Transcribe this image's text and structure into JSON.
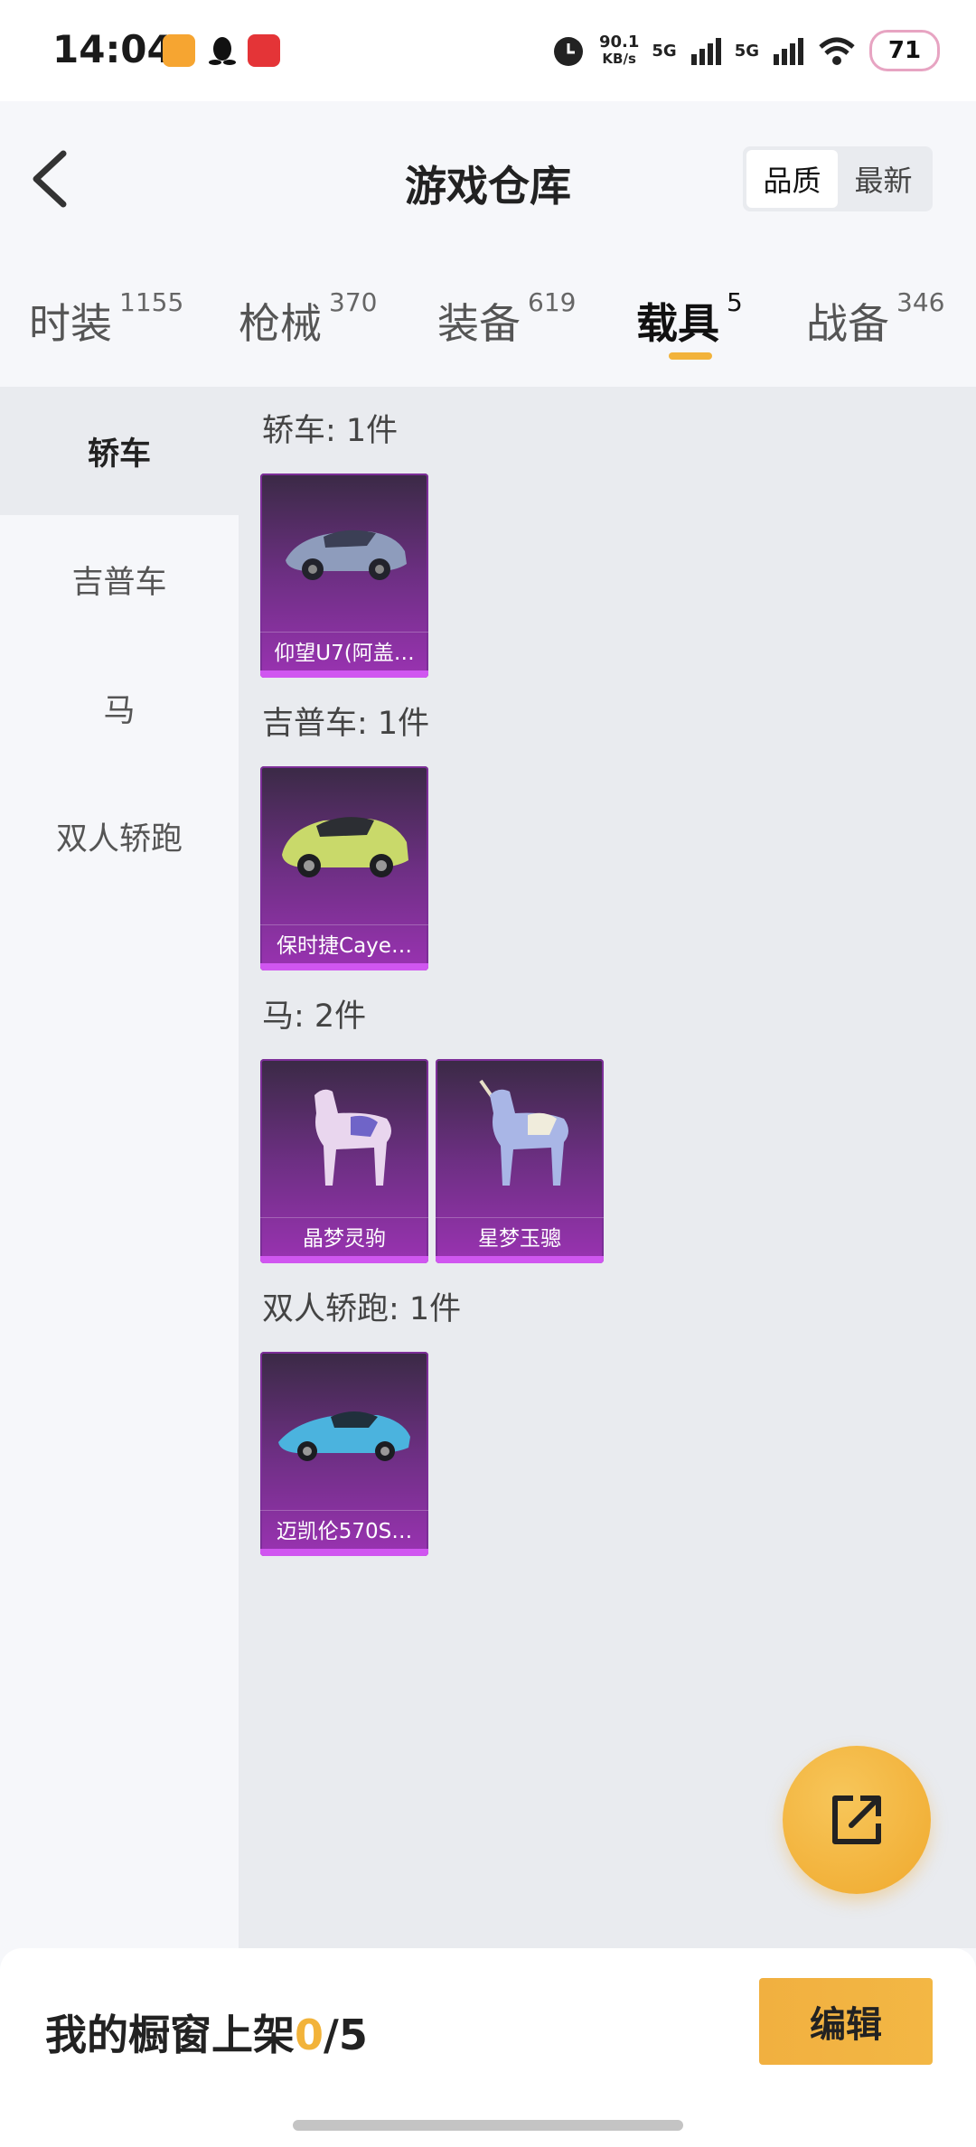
{
  "status_bar": {
    "time": "14:04",
    "net_speed_value": "90.1",
    "net_speed_unit": "KB/s",
    "signal1": "5G",
    "signal2": "5G",
    "battery": "71",
    "icons": [
      "orange-app-icon",
      "qq-icon",
      "red-app-icon",
      "alarm-icon",
      "wifi-icon",
      "battery-icon"
    ]
  },
  "header": {
    "title": "游戏仓库",
    "sort_options": [
      "品质",
      "最新"
    ],
    "sort_selected": "品质"
  },
  "tabs": [
    {
      "label": "时装",
      "count": "1155"
    },
    {
      "label": "枪械",
      "count": "370"
    },
    {
      "label": "装备",
      "count": "619"
    },
    {
      "label": "载具",
      "count": "5",
      "active": true
    },
    {
      "label": "战备",
      "count": "346"
    }
  ],
  "sidebar": {
    "items": [
      "轿车",
      "吉普车",
      "马",
      "双人轿跑"
    ],
    "active": "轿车"
  },
  "sections": [
    {
      "label": "轿车: 1件",
      "items": [
        "仰望U7(阿盖…"
      ]
    },
    {
      "label": "吉普车: 1件",
      "items": [
        "保时捷Caye…"
      ]
    },
    {
      "label": "马: 2件",
      "items": [
        "晶梦灵驹",
        "星梦玉骢"
      ]
    },
    {
      "label": "双人轿跑: 1件",
      "items": [
        "迈凯伦570S…"
      ]
    }
  ],
  "bottom": {
    "shelf_prefix": "我的橱窗上架",
    "shelf_used": "0",
    "shelf_total": "/5",
    "edit_label": "编辑"
  },
  "colors": {
    "accent": "#f2b33a",
    "card_purple": "#6d2f83",
    "card_strip": "#d056f0"
  }
}
